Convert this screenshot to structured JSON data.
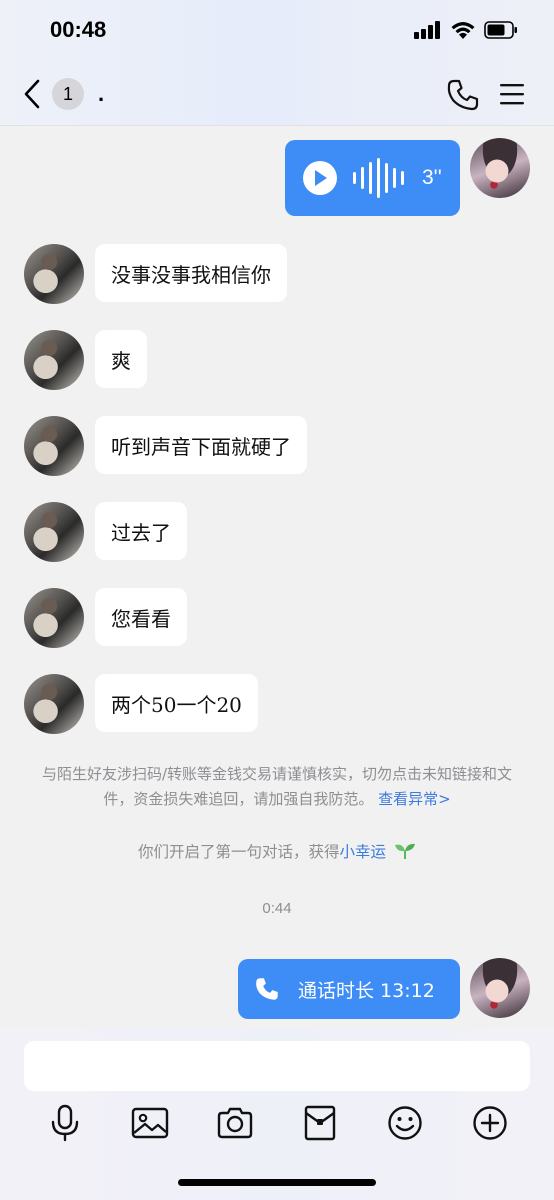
{
  "status": {
    "time": "00:48"
  },
  "nav": {
    "badge": "1",
    "title": "."
  },
  "voice_message": {
    "duration": "3''"
  },
  "messages": [
    {
      "text": "没事没事我相信你"
    },
    {
      "text": "爽"
    },
    {
      "text": "听到声音下面就硬了"
    },
    {
      "text": "过去了"
    },
    {
      "text": "您看看"
    },
    {
      "text": "两个50一个20"
    }
  ],
  "system": {
    "notice": "与陌生好友涉扫码/转账等金钱交易请谨慎核实，切勿点击未知链接和文件，资金损失难追回，请加强自我防范。",
    "notice_link": "查看异常>",
    "started": "你们开启了第一句对话，获得",
    "started_link": "小幸运",
    "time": "0:44"
  },
  "call_message": {
    "label": "通话时长 13:12"
  },
  "colors": {
    "accent": "#3e8df6",
    "link": "#3b7be0",
    "leaf": "#5cb85c"
  },
  "icons": [
    "back-icon",
    "phone-icon",
    "menu-icon",
    "play-icon",
    "mic-icon",
    "image-icon",
    "camera-icon",
    "gift-icon",
    "emoji-icon",
    "plus-icon",
    "leaf-icon"
  ]
}
